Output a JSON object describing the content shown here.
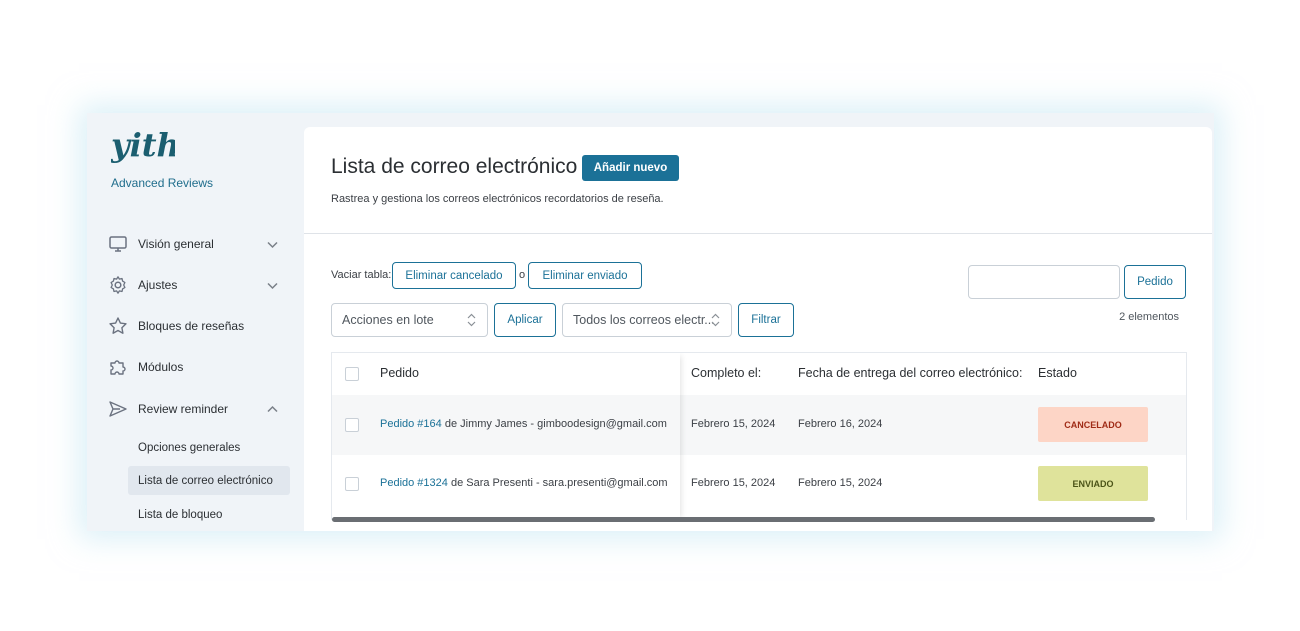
{
  "sidebar": {
    "brand": "Advanced Reviews",
    "logo_text": "yith",
    "items": [
      {
        "label": "Visión general",
        "icon": "monitor-icon"
      },
      {
        "label": "Ajustes",
        "icon": "gear-icon"
      },
      {
        "label": "Bloques de reseñas",
        "icon": "star-icon"
      },
      {
        "label": "Módulos",
        "icon": "puzzle-icon"
      },
      {
        "label": "Review reminder",
        "icon": "send-icon"
      }
    ],
    "subitems": [
      {
        "label": "Opciones generales"
      },
      {
        "label": "Lista de correo electrónico",
        "active": true
      },
      {
        "label": "Lista de bloqueo"
      }
    ]
  },
  "main": {
    "title": "Lista de correo electrónico",
    "add_new": "Añadir nuevo",
    "subtitle": "Rastrea y gestiona los correos electrónicos recordatorios de reseña.",
    "empty_table_label": "Vaciar tabla:",
    "delete_cancelled": "Eliminar cancelado",
    "or": "o",
    "delete_sent": "Eliminar enviado",
    "bulk_actions": "Acciones en lote",
    "apply": "Aplicar",
    "email_filter": "Todos los correos electr...",
    "filter": "Filtrar",
    "search_value": "",
    "search_button": "Pedido",
    "count": "2 elementos"
  },
  "table": {
    "columns": [
      "Pedido",
      "Completo el:",
      "Fecha de entrega del correo electrónico:",
      "Estado"
    ],
    "rows": [
      {
        "order_link": "Pedido #164",
        "order_rest": " de Jimmy James - gimboodesign@gmail.com",
        "completed": "Febrero 15, 2024",
        "delivery": "Febrero 16, 2024",
        "status": "CANCELADO"
      },
      {
        "order_link": "Pedido #1324",
        "order_rest": " de Sara Presenti - sara.presenti@gmail.com",
        "completed": "Febrero 15, 2024",
        "delivery": "Febrero 15, 2024",
        "status": "ENVIADO"
      }
    ]
  },
  "colors": {
    "accent": "#1b7197",
    "cancelled_bg": "#fdd5c6",
    "cancelled_text": "#a02b16",
    "sent_bg": "#dfe39b",
    "sent_text": "#4c5418"
  }
}
